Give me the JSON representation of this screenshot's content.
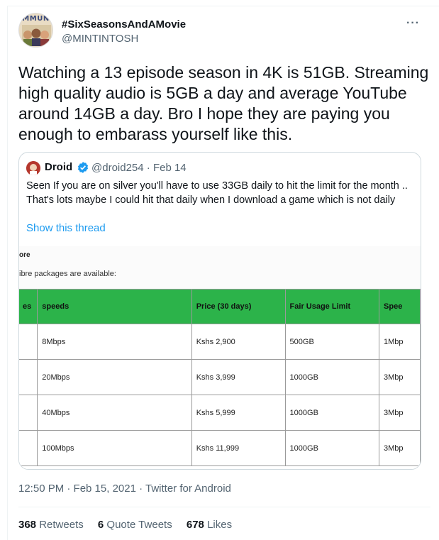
{
  "author": {
    "avatar_brand": "MMUN",
    "display_name": "#SixSeasonsAndAMovie",
    "handle": "@MINTINTOSH"
  },
  "tweet": {
    "text": "Watching a 13 episode season in 4K is 51GB.  Streaming high quality audio is 5GB a day and average YouTube around 14GB a day.  Bro I hope they are paying you enough to embarass yourself like this.",
    "more_icon": "more-dots-icon"
  },
  "quote": {
    "display_name": "Droid",
    "handle_date": "@droid254 · Feb 14",
    "text": "Seen If you are on silver you'll have to use 33GB daily to hit the limit for the month .. That's lots maybe I could hit that daily when I download a game which is not daily",
    "show_thread": "Show this thread",
    "embed": {
      "heading_fragment": "ore",
      "subheading_fragment": "ibre packages are available:",
      "headers": [
        "es",
        "speeds",
        "Price (30 days)",
        "Fair Usage Limit",
        "Spee"
      ],
      "rows": [
        [
          "",
          "8Mbps",
          "Kshs 2,900",
          "500GB",
          "1Mbp"
        ],
        [
          "",
          "20Mbps",
          "Kshs 3,999",
          "1000GB",
          "3Mbp"
        ],
        [
          "",
          "40Mbps",
          "Kshs 5,999",
          "1000GB",
          "3Mbp"
        ],
        [
          "",
          "100Mbps",
          "Kshs 11,999",
          "1000GB",
          "3Mbp"
        ]
      ],
      "header_color": "#2cb34a"
    }
  },
  "meta": {
    "timestamp": "12:50 PM · Feb 15, 2021 · Twitter for Android"
  },
  "stats": {
    "retweets_count": "368",
    "retweets_label": "Retweets",
    "quotes_count": "6",
    "quotes_label": "Quote Tweets",
    "likes_count": "678",
    "likes_label": "Likes"
  },
  "colors": {
    "link": "#1d9bf0",
    "secondary_text": "#536471",
    "primary_text": "#0f1419"
  }
}
